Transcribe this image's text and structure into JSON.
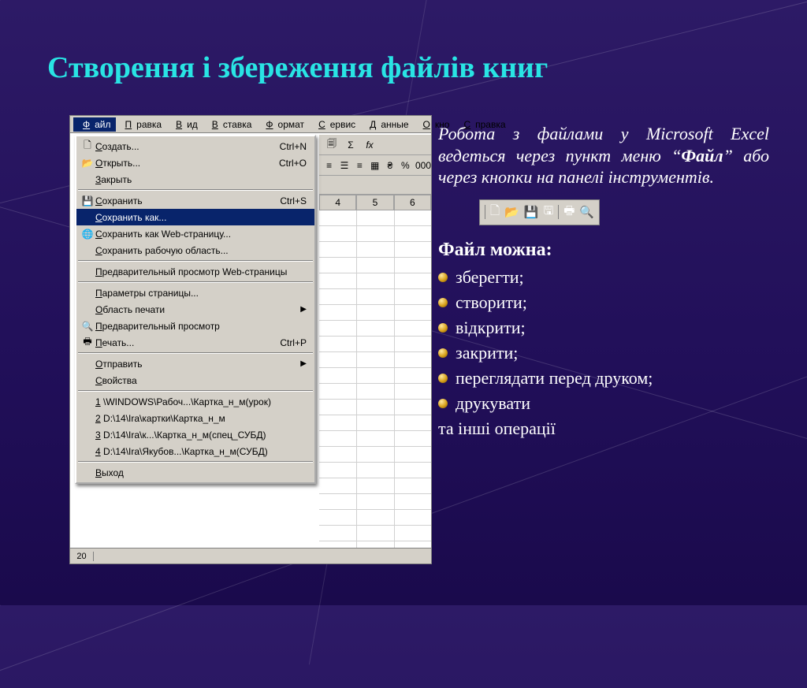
{
  "slide": {
    "title": "Створення і збереження файлів книг"
  },
  "right": {
    "paragraph_before": "Робота з файлами у Microsoft Excel ведеться через пункт меню “",
    "paragraph_kw": "Файл",
    "paragraph_after": "” або через кнопки на панелі інструментів.",
    "heading": "Файл можна:",
    "bullets": [
      "зберегти;",
      "створити;",
      "відкрити;",
      "закрити;",
      "переглядати перед друком;",
      "друкувати"
    ],
    "tail": "та інші операції"
  },
  "menubar": [
    "Файл",
    "Правка",
    "Вид",
    "Вставка",
    "Формат",
    "Сервис",
    "Данные",
    "Окно",
    "Справка"
  ],
  "dropdown": [
    {
      "icon": "new",
      "label": "Создать...",
      "shortcut": "Ctrl+N"
    },
    {
      "icon": "open",
      "label": "Открыть...",
      "shortcut": "Ctrl+O"
    },
    {
      "icon": "",
      "label": "Закрыть",
      "shortcut": ""
    },
    {
      "sep": true
    },
    {
      "icon": "save",
      "label": "Сохранить",
      "shortcut": "Ctrl+S"
    },
    {
      "icon": "",
      "label": "Сохранить как...",
      "shortcut": "",
      "hl": true
    },
    {
      "icon": "web",
      "label": "Сохранить как Web-страницу...",
      "shortcut": ""
    },
    {
      "icon": "",
      "label": "Сохранить рабочую область...",
      "shortcut": ""
    },
    {
      "sep": true
    },
    {
      "icon": "",
      "label": "Предварительный просмотр Web-страницы",
      "shortcut": ""
    },
    {
      "sep": true
    },
    {
      "icon": "",
      "label": "Параметры страницы...",
      "shortcut": ""
    },
    {
      "icon": "",
      "label": "Область печати",
      "shortcut": "",
      "submenu": true
    },
    {
      "icon": "prev",
      "label": "Предварительный просмотр",
      "shortcut": ""
    },
    {
      "icon": "print",
      "label": "Печать...",
      "shortcut": "Ctrl+P"
    },
    {
      "sep": true
    },
    {
      "icon": "",
      "label": "Отправить",
      "shortcut": "",
      "submenu": true
    },
    {
      "icon": "",
      "label": "Свойства",
      "shortcut": ""
    },
    {
      "sep": true
    },
    {
      "icon": "",
      "label": "1 \\WINDOWS\\Рабоч...\\Картка_н_м(урок)",
      "shortcut": ""
    },
    {
      "icon": "",
      "label": "2 D:\\14\\Ira\\картки\\Картка_н_м",
      "shortcut": ""
    },
    {
      "icon": "",
      "label": "3 D:\\14\\Ira\\к...\\Картка_н_м(спец_СУБД)",
      "shortcut": ""
    },
    {
      "icon": "",
      "label": "4 D:\\14\\Ira\\Якубов...\\Картка_н_м(СУБД)",
      "shortcut": ""
    },
    {
      "sep": true
    },
    {
      "icon": "",
      "label": "Выход",
      "shortcut": ""
    }
  ],
  "colhdr": [
    "4",
    "5",
    "6"
  ],
  "row_label": "20",
  "toolbar2_labels": {
    "sigma": "Σ",
    "fx": "fx",
    "percent": "%",
    "thousands": "000"
  },
  "mini_toolbar_icons": [
    "new-file-icon",
    "open-folder-icon",
    "save-icon",
    "save-web-icon",
    "print-icon",
    "print-preview-icon"
  ]
}
